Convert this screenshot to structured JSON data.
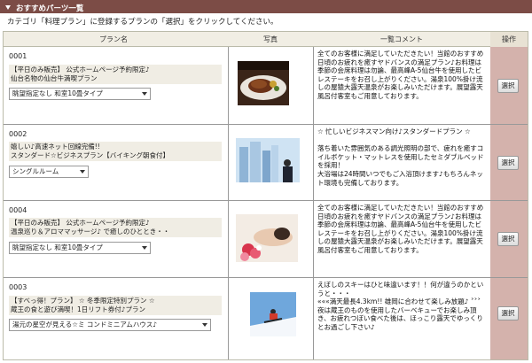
{
  "window": {
    "title": "おすすめパーツ一覧"
  },
  "instruction": "カテゴリ「料理プラン」に登録するプランの「選択」をクリックしてください。",
  "columns": [
    "プラン名",
    "写真",
    "一覧コメント",
    "操作"
  ],
  "select_label": "選択",
  "rows": [
    {
      "id": "0001",
      "plan_text": "【平日のみ販売】 公式ホームページ予約限定♪\n仙台名物の仙台牛満喫プラン",
      "option": "眺望指定なし 和室10畳タイプ",
      "photo_icon": "steak-dinner-photo",
      "comment": "全てのお客様に満足していただきたい！当館のおすすめ\n日頃のお疲れを癒すヤドバンスの満足プラン♪お料理は季節の会席料理は勿論、最高峰A-5仙台牛を使用したビレステーキをお召し上がりください。湯泉100%掛け流しの屋猿大露天温泉がお楽しみいただけます。展望露天風呂付客室もご用意しております。"
    },
    {
      "id": "0002",
      "plan_text": "嬉しい♪高速ネット回線完備!!\nスタンダード☆ビジネスプラン【バイキング朝食付】",
      "option": "シングルルーム",
      "photo_icon": "businessman-skyline-photo",
      "comment": "☆ 忙しいビジネスマン向け♪スタンダードプラン ☆\n\n落ち着いた雰囲気のある調光照明の部で、疲れを癒すコイルボケット・マットレスを使用したセミダブルベッドを採用！\n大浴場は24時間いつでもご入浴頂けます♪もちろんネット環境も完備しております。"
    },
    {
      "id": "0004",
      "plan_text": "【平日のみ販売】 公式ホームページ予約限定♪\n温泉巡り＆アロママッサージ♪ で癒しのひととき・・",
      "option": "眺望指定なし 和室10畳タイプ",
      "photo_icon": "spa-flowers-photo",
      "comment": "全てのお客様に満足していただきたい！当館のおすすめ\n日頃のお疲れを癒すヤドバンスの満足プラン♪お料理は季節の会席料理は勿論、最高峰A-5仙台牛を使用したビレステーキをお召し上がりください。湯泉100%掛け流しの屋猿大露天温泉がお楽しみいただけます。展望露天風呂付客室もご用意しております。"
    },
    {
      "id": "0003",
      "plan_text": "【すべっ得！プラン】 ☆ 冬季限定特別プラン ☆\n蔵王の食と遊び満喫！1日リフト券付♪プラン",
      "option": "湯元の星空が見える☆ミ コンドミニアムハウス♪",
      "photo_icon": "skier-jump-photo",
      "comment": "えぼしのスキーはひと味違います！！何が違うのかというと・・・\n«««満天最長4.3km!! 雄岡に合わせて楽しみ放題♪ ˃˃˃\n夜は蔵王のものを使用したバーベキューでお楽しみ頂き、お疲れつぼい食べた後は、ほっこり露天でゆっくりとお過ごし下さい♪"
    }
  ]
}
